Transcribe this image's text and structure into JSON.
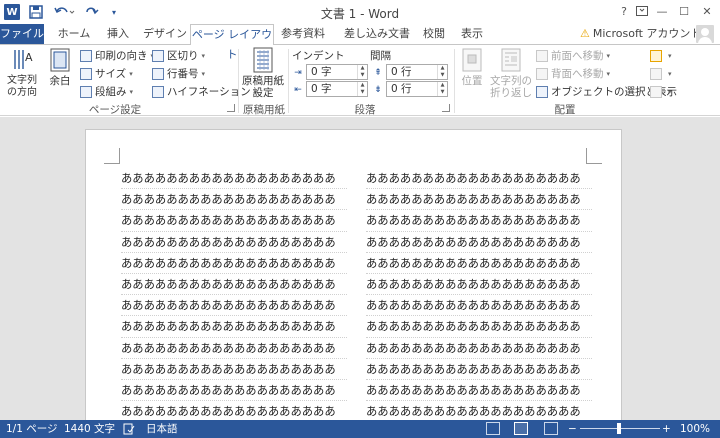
{
  "title_bar": {
    "title": "文書 1 - Word",
    "app_icon": "W",
    "help": "?",
    "ribbon_options": "🗔",
    "minimize": "—",
    "maximize": "☐",
    "close": "✕"
  },
  "tabs": [
    {
      "label": "ファイル"
    },
    {
      "label": "ホーム"
    },
    {
      "label": "挿入"
    },
    {
      "label": "デザイン"
    },
    {
      "label": "ページ レイアウト",
      "active": true
    },
    {
      "label": "参考資料"
    },
    {
      "label": "差し込み文書"
    },
    {
      "label": "校閲"
    },
    {
      "label": "表示"
    }
  ],
  "account": {
    "label": "Microsoft アカウント",
    "warning_icon": "⚠"
  },
  "ribbon": {
    "page_setup": {
      "label": "ページ設定",
      "text_direction": "文字列の方向",
      "margins": "余白",
      "orientation": "印刷の向き",
      "size": "サイズ",
      "columns": "段組み",
      "breaks": "区切り",
      "line_numbers": "行番号",
      "hyphenation": "ハイフネーション"
    },
    "manuscript": {
      "label": "原稿用紙",
      "settings_line1": "原稿用紙",
      "settings_line2": "設定"
    },
    "paragraph": {
      "label": "段落",
      "indent_label": "インデント",
      "spacing_label": "間隔",
      "indent_left": "0 字",
      "indent_right": "0 字",
      "spacing_before": "0 行",
      "spacing_after": "0 行"
    },
    "arrange": {
      "label": "配置",
      "position": "位置",
      "wrap_line1": "文字列の",
      "wrap_line2": "折り返し",
      "bring_forward": "前面へ移動",
      "send_backward": "背面へ移動",
      "selection_pane": "オブジェクトの選択と表示"
    }
  },
  "document": {
    "line_text": "あああああああああああああああああああ",
    "lines_per_column": 13
  },
  "status_bar": {
    "page": "1/1 ページ",
    "words": "1440 文字",
    "language": "日本語",
    "zoom": "100%",
    "zoom_minus": "−",
    "zoom_plus": "+"
  },
  "colors": {
    "accent": "#2b579a",
    "background": "#e3e3e3"
  }
}
